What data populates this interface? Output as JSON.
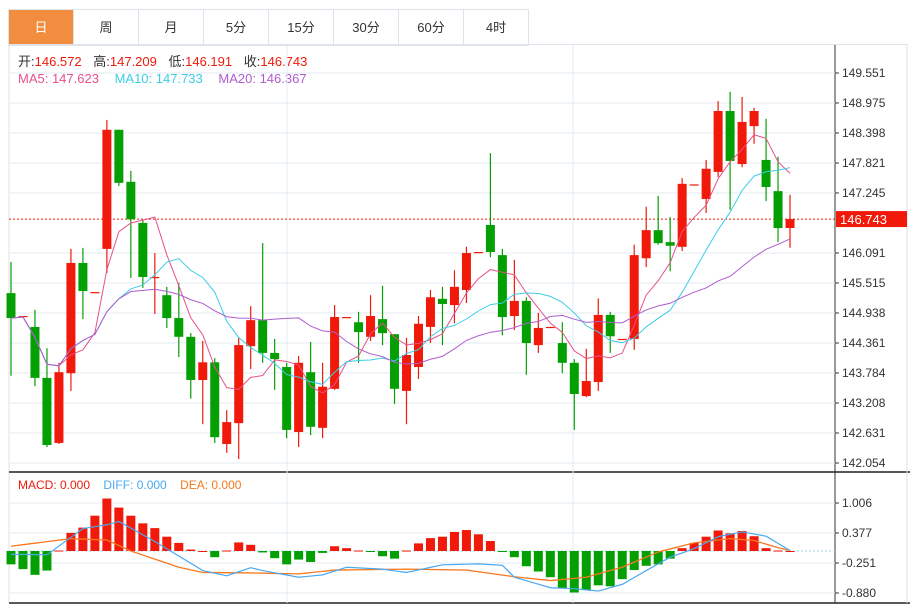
{
  "tabs": [
    {
      "label": "日",
      "active": true
    },
    {
      "label": "周"
    },
    {
      "label": "月"
    },
    {
      "label": "5分"
    },
    {
      "label": "15分"
    },
    {
      "label": "30分"
    },
    {
      "label": "60分"
    },
    {
      "label": "4时"
    }
  ],
  "ohlc_info": {
    "open_label": "开:",
    "open": "146.572",
    "high_label": "高:",
    "high": "147.209",
    "low_label": "低:",
    "low": "146.191",
    "close_label": "收:",
    "close": "146.743"
  },
  "ma_info": {
    "ma5": "MA5: 147.623",
    "ma10": "MA10: 147.733",
    "ma20": "MA20: 146.367"
  },
  "macd_info": {
    "macd": "MACD: 0.000",
    "diff": "DIFF: 0.000",
    "dea": "DEA: 0.000"
  },
  "colors": {
    "up": "#f0190a",
    "down": "#04a003",
    "ma5": "#e8508a",
    "ma10": "#3ccde6",
    "ma20": "#b05ccf",
    "diff": "#4aa8f0",
    "dea": "#f7781e",
    "accent": "#f28c3e"
  },
  "chart_data": {
    "type": "candlestick",
    "price_axis": {
      "ticks": [
        "149.551",
        "148.975",
        "148.398",
        "147.821",
        "147.245",
        "146.091",
        "145.515",
        "144.938",
        "144.361",
        "143.784",
        "143.208",
        "142.631",
        "142.054"
      ],
      "range": [
        142.054,
        149.551
      ]
    },
    "last_price": "146.743",
    "candles": [
      [
        145.32,
        145.92,
        143.73,
        144.84
      ],
      [
        144.87,
        144.88,
        144.88,
        144.88
      ],
      [
        144.67,
        145.0,
        143.53,
        143.69
      ],
      [
        143.69,
        144.26,
        142.36,
        142.4
      ],
      [
        142.44,
        143.98,
        142.42,
        143.8
      ],
      [
        143.78,
        146.17,
        143.44,
        145.9
      ],
      [
        145.9,
        146.19,
        144.82,
        145.36
      ],
      [
        145.33,
        145.34,
        145.34,
        145.34
      ],
      [
        146.17,
        148.65,
        145.71,
        148.46
      ],
      [
        148.46,
        148.46,
        147.38,
        147.44
      ],
      [
        147.46,
        147.67,
        145.61,
        146.74
      ],
      [
        146.67,
        146.72,
        145.42,
        145.63
      ],
      [
        145.62,
        146.09,
        144.92,
        145.63
      ],
      [
        145.28,
        145.44,
        144.65,
        144.84
      ],
      [
        144.84,
        145.52,
        144.09,
        144.48
      ],
      [
        144.48,
        144.55,
        143.29,
        143.65
      ],
      [
        143.65,
        144.4,
        142.8,
        143.99
      ],
      [
        143.99,
        144.07,
        142.44,
        142.55
      ],
      [
        142.42,
        143.07,
        142.25,
        142.84
      ],
      [
        142.82,
        144.46,
        142.13,
        144.32
      ],
      [
        144.3,
        145.07,
        143.86,
        144.8
      ],
      [
        144.8,
        146.28,
        143.98,
        144.17
      ],
      [
        144.17,
        144.44,
        143.46,
        144.05
      ],
      [
        143.9,
        143.98,
        142.53,
        142.69
      ],
      [
        142.65,
        144.11,
        142.36,
        143.98
      ],
      [
        143.8,
        144.38,
        142.59,
        142.75
      ],
      [
        142.73,
        143.98,
        142.53,
        143.52
      ],
      [
        143.48,
        145.09,
        143.46,
        144.86
      ],
      [
        144.85,
        144.86,
        144.86,
        144.86
      ],
      [
        144.76,
        144.96,
        143.98,
        144.57
      ],
      [
        144.48,
        145.28,
        144.4,
        144.88
      ],
      [
        144.82,
        145.46,
        144.32,
        144.55
      ],
      [
        144.53,
        144.53,
        143.19,
        143.48
      ],
      [
        143.44,
        144.46,
        142.8,
        144.13
      ],
      [
        143.9,
        144.88,
        143.67,
        144.73
      ],
      [
        144.67,
        145.38,
        144.36,
        145.24
      ],
      [
        145.21,
        145.44,
        144.32,
        145.11
      ],
      [
        145.09,
        145.76,
        144.74,
        145.44
      ],
      [
        145.38,
        146.21,
        145.13,
        146.09
      ],
      [
        146.1,
        146.11,
        146.11,
        146.11
      ],
      [
        146.63,
        148.01,
        146.01,
        146.11
      ],
      [
        146.05,
        146.17,
        144.51,
        144.86
      ],
      [
        144.88,
        145.96,
        144.61,
        145.17
      ],
      [
        145.17,
        145.24,
        143.75,
        144.36
      ],
      [
        144.32,
        144.94,
        144.17,
        144.65
      ],
      [
        144.66,
        144.67,
        144.67,
        144.67
      ],
      [
        144.36,
        144.76,
        143.78,
        143.98
      ],
      [
        143.98,
        144.05,
        142.69,
        143.38
      ],
      [
        143.34,
        144.25,
        143.32,
        143.63
      ],
      [
        143.61,
        145.22,
        143.44,
        144.9
      ],
      [
        144.9,
        144.96,
        144.17,
        144.49
      ],
      [
        144.44,
        144.44,
        144.44,
        144.44
      ],
      [
        144.44,
        146.25,
        144.23,
        146.05
      ],
      [
        145.99,
        146.98,
        145.82,
        146.53
      ],
      [
        146.53,
        147.19,
        146.25,
        146.28
      ],
      [
        146.3,
        146.78,
        145.74,
        146.23
      ],
      [
        146.21,
        147.53,
        146.13,
        147.42
      ],
      [
        147.4,
        147.41,
        147.41,
        147.41
      ],
      [
        147.13,
        147.88,
        146.86,
        147.71
      ],
      [
        147.65,
        149.01,
        147.55,
        148.82
      ],
      [
        148.82,
        149.19,
        146.92,
        147.86
      ],
      [
        147.8,
        149.09,
        147.74,
        148.61
      ],
      [
        148.53,
        148.88,
        148.19,
        148.82
      ],
      [
        147.88,
        148.67,
        147.09,
        147.36
      ],
      [
        147.28,
        147.94,
        146.3,
        146.57
      ],
      [
        146.572,
        147.209,
        146.191,
        146.743
      ]
    ],
    "macd_axis": {
      "ticks": [
        "1.006",
        "0.377",
        "-0.251",
        "-0.880"
      ],
      "range": [
        -0.94,
        1.2
      ]
    },
    "macd_hist": [
      -0.28,
      -0.38,
      -0.5,
      -0.41,
      0.01,
      0.38,
      0.49,
      0.74,
      1.1,
      0.91,
      0.74,
      0.58,
      0.48,
      0.3,
      0.17,
      0.03,
      0.0,
      -0.13,
      0.01,
      0.18,
      0.13,
      -0.03,
      -0.15,
      -0.28,
      -0.18,
      -0.23,
      -0.04,
      0.1,
      0.06,
      0.01,
      -0.01,
      -0.11,
      -0.16,
      0.01,
      0.16,
      0.27,
      0.3,
      0.4,
      0.44,
      0.35,
      0.21,
      -0.02,
      -0.13,
      -0.32,
      -0.43,
      -0.55,
      -0.78,
      -0.87,
      -0.82,
      -0.72,
      -0.74,
      -0.59,
      -0.4,
      -0.31,
      -0.28,
      -0.16,
      0.06,
      0.17,
      0.3,
      0.43,
      0.37,
      0.42,
      0.31,
      0.06,
      0.01,
      0.0
    ],
    "diff_points": [
      [
        0,
        -0.07
      ],
      [
        3,
        -0.08
      ],
      [
        6,
        0.47
      ],
      [
        8,
        0.55
      ],
      [
        9,
        0.62
      ],
      [
        12,
        0.2
      ],
      [
        16,
        -0.41
      ],
      [
        18,
        -0.52
      ],
      [
        20,
        -0.35
      ],
      [
        21,
        -0.41
      ],
      [
        24,
        -0.55
      ],
      [
        26,
        -0.5
      ],
      [
        28,
        -0.34
      ],
      [
        31,
        -0.38
      ],
      [
        33,
        -0.45
      ],
      [
        36,
        -0.29
      ],
      [
        39,
        -0.27
      ],
      [
        41,
        -0.3
      ],
      [
        42,
        -0.55
      ],
      [
        45,
        -0.77
      ],
      [
        47,
        -0.79
      ],
      [
        49,
        -0.84
      ],
      [
        51,
        -0.7
      ],
      [
        53,
        -0.41
      ],
      [
        55,
        -0.13
      ],
      [
        57,
        0.05
      ],
      [
        59,
        0.3
      ],
      [
        61,
        0.4
      ],
      [
        63,
        0.31
      ],
      [
        65,
        0.01
      ]
    ],
    "dea_points": [
      [
        0,
        0.1
      ],
      [
        5,
        0.26
      ],
      [
        8,
        0.23
      ],
      [
        10,
        0.0
      ],
      [
        14,
        -0.34
      ],
      [
        16,
        -0.45
      ],
      [
        20,
        -0.46
      ],
      [
        24,
        -0.48
      ],
      [
        27,
        -0.4
      ],
      [
        33,
        -0.38
      ],
      [
        38,
        -0.4
      ],
      [
        42,
        -0.54
      ],
      [
        45,
        -0.62
      ],
      [
        48,
        -0.55
      ],
      [
        51,
        -0.34
      ],
      [
        54,
        -0.02
      ],
      [
        57,
        0.17
      ],
      [
        60,
        0.26
      ],
      [
        62,
        0.22
      ],
      [
        64,
        0.07
      ],
      [
        65,
        0.01
      ]
    ]
  }
}
